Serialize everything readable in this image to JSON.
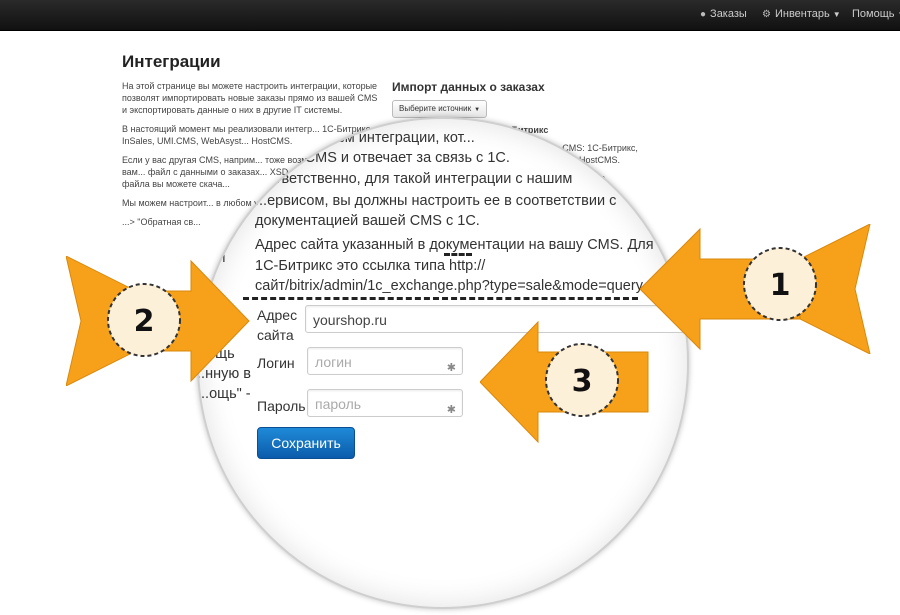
{
  "navbar": {
    "orders_label": "Заказы",
    "inventory_label": "Инвентарь",
    "help_label": "Помощь",
    "orders_icon": "globe-icon",
    "inventory_icon": "gears-icon"
  },
  "page": {
    "title": "Интеграции",
    "intro": {
      "p1": "На этой странице вы можете настроить интеграции, которые позволят импортировать новые заказы прямо из вашей CMS и экспортировать данные о них в другие IT системы.",
      "p2": "В настоящий момент мы реализовали интегр... 1С-Битрикс, InSales, UMI.CMS, WebAsyst... HostCMS.",
      "p3": "Если у вас другая CMS, наприм... тоже возможен. Для этого вам... файл с данными о заказах... XSD-схему формата мож... файла вы можете скача...",
      "p4": "Мы можем настроит... в любом удобно... ...нам",
      "p5": "...> \"Обратная св..."
    },
    "import": {
      "title": "Импорт данных о заказах",
      "select_label": "Выберите источник",
      "bitrix_head": "С-Битрикс",
      "right_p1": "...ли CMS: 1С-Битрикс, ...umpla, HostCMS.",
      "right_p2": "...уже"
    }
  },
  "magnifier": {
    "line1": "...ем механизм интеграции, кот...",
    "line2": "...в эти CMS и отвечает за связь с 1С.",
    "line3": "...ответственно, для такой интеграции с нашим",
    "line4": "...ервисом, вы должны настроить ее в соответствии с",
    "line5": "документацией вашей CMS с 1С.",
    "p2_line1": "Адрес сайта указанный в документации на вашу CMS. Для",
    "p2_line2": "1С-Битрикс это ссылка типа http://",
    "p2_line3": "сайт/bitrix/admin/1c_exchange.php?type=sale&mode=query",
    "form": {
      "site_label_1": "Адрес",
      "site_label_2": "сайта",
      "site_value": "yourshop.ru",
      "login_label": "Логин",
      "login_placeholder": "логин",
      "password_label": "Пароль",
      "password_placeholder": "пароль",
      "save_label": "Сохранить"
    },
    "left_fragments": {
      "f1": "...ки",
      "f2": "...ощь",
      "f3": "...нную в",
      "f4": "...ощь\" -"
    }
  },
  "callouts": {
    "badge1": "1",
    "badge2": "2",
    "badge3": "3",
    "arrow_color": "#f7a11a",
    "badge_fill": "#fdf0d8"
  }
}
